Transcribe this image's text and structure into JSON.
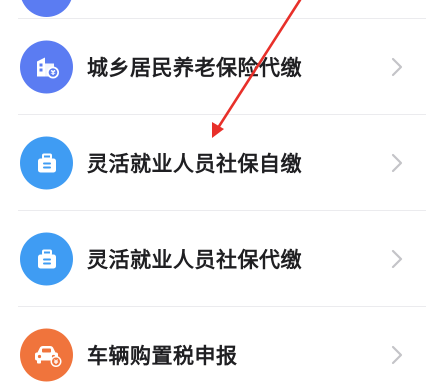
{
  "menu": {
    "items": [
      {
        "label": "城乡居民养老保险代缴",
        "icon": "building-id-icon",
        "icon_color": "#5b7cf2"
      },
      {
        "label": "灵活就业人员社保自缴",
        "icon": "briefcase-icon",
        "icon_color": "#3f9cf3"
      },
      {
        "label": "灵活就业人员社保代缴",
        "icon": "briefcase-icon",
        "icon_color": "#3f9cf3"
      },
      {
        "label": "车辆购置税申报",
        "icon": "car-tax-icon",
        "icon_color": "#f0743c"
      }
    ],
    "chevron_icon": "chevron-right-icon",
    "chevron_color": "#c4c4c8"
  },
  "annotation": {
    "icon": "red-arrow-icon",
    "color": "#e8302a"
  }
}
